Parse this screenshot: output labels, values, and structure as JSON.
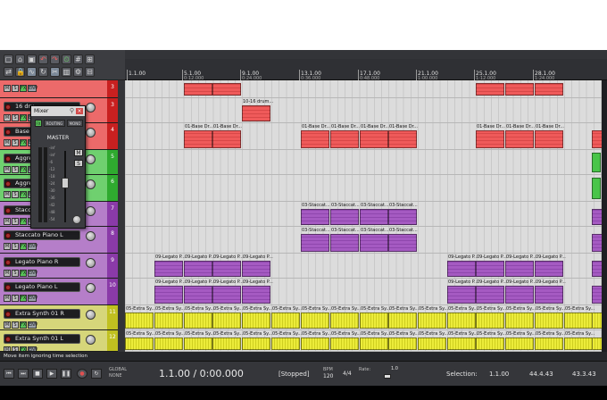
{
  "toolbar": {
    "buttons": [
      "new-project-icon",
      "open-icon",
      "save-icon",
      "undo-icon",
      "redo-icon",
      "metronome-icon",
      "grid-icon",
      "snap-icon",
      "ripple-icon",
      "lock-icon",
      "envelope-icon",
      "loop-icon",
      "razor-icon",
      "mixer-icon",
      "fx-icon",
      "trim-icon"
    ]
  },
  "tracks": [
    {
      "name": "",
      "num": "3",
      "color": "#ec6a6a",
      "numColor": "#c82020"
    },
    {
      "name": "16 dru",
      "num": "3",
      "color": "#ec6a6a",
      "numColor": "#c82020"
    },
    {
      "name": "Base D",
      "num": "4",
      "color": "#ec6a6a",
      "numColor": "#c82020"
    },
    {
      "name": "Aggres",
      "num": "5",
      "color": "#6fd06f",
      "numColor": "#2faa2f"
    },
    {
      "name": "Aggres",
      "num": "6",
      "color": "#6fd06f",
      "numColor": "#2faa2f"
    },
    {
      "name": "Stacca",
      "num": "7",
      "color": "#b57ec9",
      "numColor": "#8a3aa8"
    },
    {
      "name": "Staccato Piano L",
      "num": "8",
      "color": "#b57ec9",
      "numColor": "#8a3aa8"
    },
    {
      "name": "Legato Piano R",
      "num": "9",
      "color": "#b57ec9",
      "numColor": "#8a3aa8"
    },
    {
      "name": "Legato Piano L",
      "num": "10",
      "color": "#b57ec9",
      "numColor": "#8a3aa8"
    },
    {
      "name": "Extra Synth 01 R",
      "num": "11",
      "color": "#d6d67a",
      "numColor": "#c0c020"
    },
    {
      "name": "Extra Synth 01 L",
      "num": "12",
      "color": "#d6d67a",
      "numColor": "#c0c020"
    }
  ],
  "track_buttons": {
    "mute": "M",
    "solo": "S",
    "fx": "FX",
    "io": "ENV"
  },
  "ruler": [
    {
      "bar": "1.1.00",
      "time": ""
    },
    {
      "bar": "5.1.00",
      "time": "0:12.000"
    },
    {
      "bar": "9.1.00",
      "time": "0:24.000"
    },
    {
      "bar": "13.1.00",
      "time": "0:36.000"
    },
    {
      "bar": "17.1.00",
      "time": "0:48.000"
    },
    {
      "bar": "21.1.00",
      "time": "1:00.000"
    },
    {
      "bar": "25.1.00",
      "time": "1:12.000"
    },
    {
      "bar": "28.1.00",
      "time": "1:24.000"
    }
  ],
  "clip_labels": {
    "drums": "10-16 drum...",
    "base": "01-Base Dr...",
    "staccato": "03-Staccat...",
    "legato": "09-Legato P...",
    "extra": "05-Extra Sy..."
  },
  "mixer": {
    "title": "Mixer",
    "close": "×",
    "routing": "ROUTING",
    "mono": "MONO",
    "master": "MASTER",
    "mute": "M",
    "solo": "S",
    "scale": [
      "-inf",
      "-inf",
      "-6",
      "-12",
      "-18",
      "-24",
      "-30",
      "-36",
      "-42",
      "-48",
      "-54"
    ]
  },
  "status": {
    "text": "Move item ignoring time selection"
  },
  "transport": {
    "position": "1.1.00 / 0:00.000",
    "state": "[Stopped]",
    "bpm_label": "BPM",
    "bpm_value": "120",
    "sig": "4/4",
    "rate_label": "Rate:",
    "rate_value": "1.0",
    "global_label": "GLOBAL",
    "none_label": "NONE",
    "selection_label": "Selection:",
    "sel_start": "1.1.00",
    "sel_end": "44.4.43",
    "sel_len": "43.3.43"
  }
}
